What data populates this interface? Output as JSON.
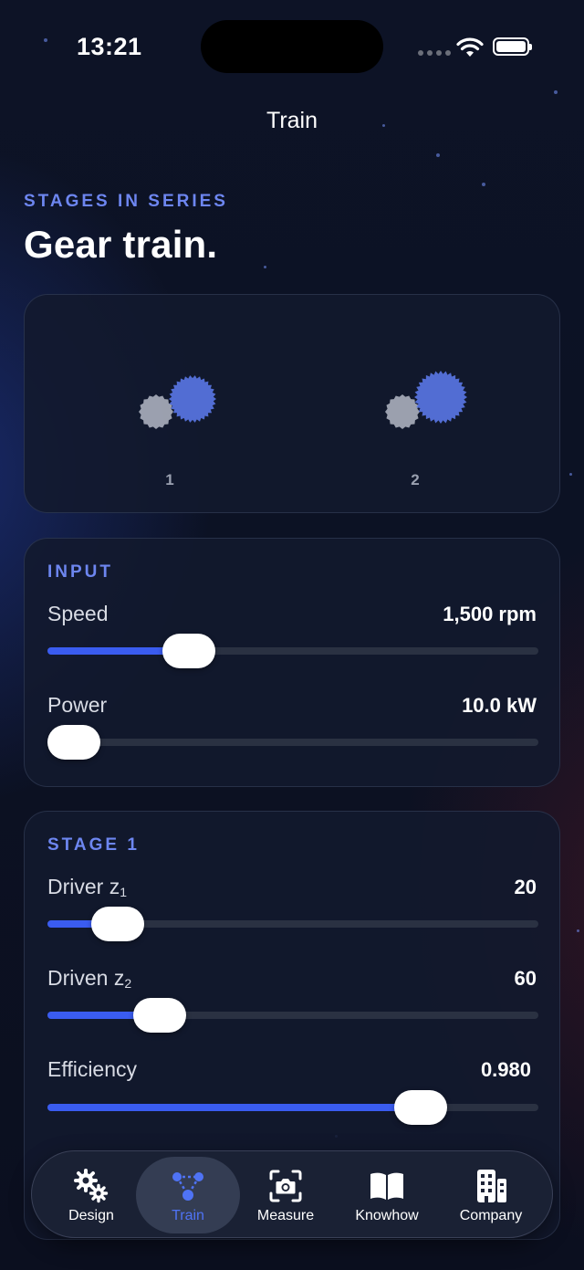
{
  "status_bar": {
    "time": "13:21"
  },
  "nav": {
    "title": "Train"
  },
  "header": {
    "eyebrow": "STAGES IN SERIES",
    "title": "Gear train."
  },
  "stages": [
    {
      "label": "1"
    },
    {
      "label": "2"
    }
  ],
  "input": {
    "section": "INPUT",
    "speed": {
      "label": "Speed",
      "value": "1,500 rpm",
      "fraction": 0.28
    },
    "power": {
      "label": "Power",
      "value": "10.0 kW",
      "fraction": 0.02
    }
  },
  "stage1": {
    "section": "STAGE 1",
    "driver": {
      "label": "Driver z",
      "sub": "1",
      "value": "20",
      "fraction": 0.13
    },
    "driven": {
      "label": "Driven z",
      "sub": "2",
      "value": "60",
      "fraction": 0.22
    },
    "efficiency": {
      "label": "Efficiency",
      "value": "0.980",
      "fraction": 0.77
    }
  },
  "tabs": [
    {
      "label": "Design",
      "icon": "gears-icon",
      "active": false
    },
    {
      "label": "Train",
      "icon": "train-nodes-icon",
      "active": true
    },
    {
      "label": "Measure",
      "icon": "camera-scan-icon",
      "active": false
    },
    {
      "label": "Knowhow",
      "icon": "book-icon",
      "active": false
    },
    {
      "label": "Company",
      "icon": "building-icon",
      "active": false
    }
  ],
  "colors": {
    "accent": "#3a5cf0",
    "section_label": "#6d86f0",
    "active_tab": "#4f73f5",
    "driver_gear": "#b4b9c6",
    "driven_gear": "#5a77e6"
  }
}
